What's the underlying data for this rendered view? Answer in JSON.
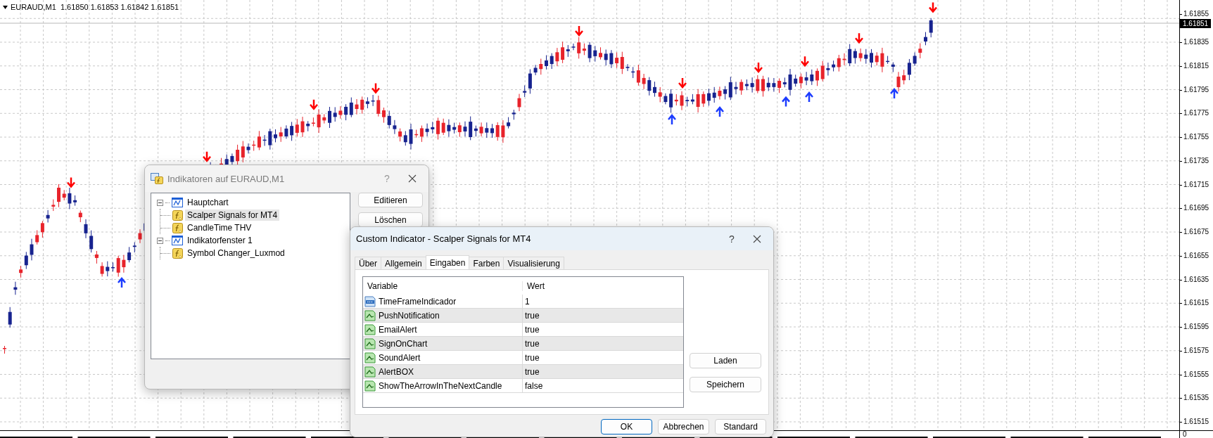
{
  "chart": {
    "header": "EURAUD,M1  1.61850 1.61853 1.61842 1.61851",
    "current_price": "1.61851",
    "price_labels": [
      "1.61855",
      "1.61835",
      "1.61815",
      "1.61795",
      "1.61775",
      "1.61755",
      "1.61735",
      "1.61715",
      "1.61695",
      "1.61675",
      "1.61655",
      "1.61635",
      "1.61615",
      "1.61595",
      "1.61575",
      "1.61555",
      "1.61535",
      "1.61515"
    ],
    "subwindow_label": "0"
  },
  "indicators_dialog": {
    "title": "Indikatoren auf EURAUD,M1",
    "help": "?",
    "tree": [
      {
        "label": "Hauptchart",
        "kind": "window",
        "expanded": true,
        "selected": false,
        "children": [
          {
            "label": "Scalper Signals for MT4",
            "kind": "indicator",
            "selected": true
          },
          {
            "label": "CandleTime THV",
            "kind": "indicator",
            "selected": false
          }
        ]
      },
      {
        "label": "Indikatorfenster 1",
        "kind": "window",
        "expanded": true,
        "selected": false,
        "children": [
          {
            "label": "Symbol Changer_Luxmod",
            "kind": "indicator",
            "selected": false
          }
        ]
      }
    ],
    "buttons": [
      "Editieren",
      "Löschen"
    ]
  },
  "custom_indicator_dialog": {
    "title": "Custom Indicator - Scalper Signals for MT4",
    "help": "?",
    "tabs": [
      {
        "label": "Über",
        "selected": false
      },
      {
        "label": "Allgemein",
        "selected": false
      },
      {
        "label": "Eingaben",
        "selected": true
      },
      {
        "label": "Farben",
        "selected": false
      },
      {
        "label": "Visualisierung",
        "selected": false
      }
    ],
    "columns": [
      "Variable",
      "Wert"
    ],
    "rows": [
      {
        "variable": "TimeFrameIndicador",
        "value": "1",
        "kind": "int"
      },
      {
        "variable": "PushNotification",
        "value": "true",
        "kind": "bool"
      },
      {
        "variable": "EmailAlert",
        "value": "true",
        "kind": "bool"
      },
      {
        "variable": "SignOnChart",
        "value": "true",
        "kind": "bool"
      },
      {
        "variable": "SoundAlert",
        "value": "true",
        "kind": "bool"
      },
      {
        "variable": "AlertBOX",
        "value": "true",
        "kind": "bool"
      },
      {
        "variable": "ShowTheArrowInTheNextCandle",
        "value": "false",
        "kind": "bool"
      }
    ],
    "side_buttons": [
      "Laden",
      "Speichern"
    ],
    "buttons": [
      {
        "label": "OK",
        "default": true
      },
      {
        "label": "Abbrechen",
        "default": false
      },
      {
        "label": "Standard",
        "default": false
      }
    ]
  }
}
